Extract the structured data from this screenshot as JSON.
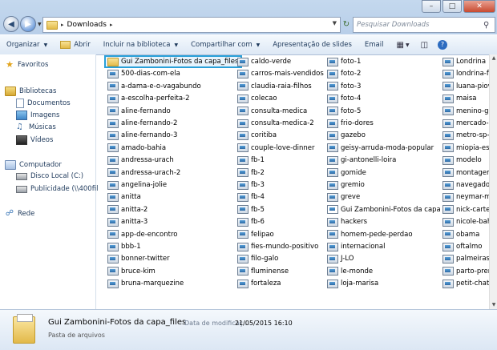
{
  "address": {
    "path": "Downloads"
  },
  "search": {
    "placeholder": "Pesquisar Downloads"
  },
  "toolbar": {
    "organize": "Organizar",
    "open": "Abrir",
    "include": "Incluir na biblioteca",
    "share": "Compartilhar com",
    "slideshow": "Apresentação de slides",
    "email": "Email"
  },
  "nav_pane": {
    "favorites": "Favoritos",
    "libraries": "Bibliotecas",
    "documents": "Documentos",
    "images": "Imagens",
    "music": "Músicas",
    "videos": "Vídeos",
    "computer": "Computador",
    "local_disk": "Disco Local (C:)",
    "network_drive": "Publicidade (\\\\400fil",
    "network": "Rede"
  },
  "files": {
    "col1": [
      "Gui Zambonini-Fotos da capa_files",
      "500-dias-com-ela",
      "a-dama-e-o-vagabundo",
      "a-escolha-perfeita-2",
      "aline-fernando",
      "aline-fernando-2",
      "aline-fernando-3",
      "amado-bahia",
      "andressa-urach",
      "andressa-urach-2",
      "angelina-jolie",
      "anitta",
      "anitta-2",
      "anitta-3",
      "app-de-encontro",
      "bbb-1",
      "bonner-twitter",
      "bruce-kim",
      "bruna-marquezine"
    ],
    "col2": [
      "caldo-verde",
      "carros-mais-vendidos",
      "claudia-raia-filhos",
      "colecao",
      "consulta-medica",
      "consulta-medica-2",
      "coritiba",
      "couple-love-dinner",
      "fb-1",
      "fb-2",
      "fb-3",
      "fb-4",
      "fb-5",
      "fb-6",
      "felipao",
      "fies-mundo-positivo",
      "filo-galo",
      "fluminense",
      "fortaleza"
    ],
    "col3": [
      "foto-1",
      "foto-2",
      "foto-3",
      "foto-4",
      "foto-5",
      "frio-dores",
      "gazebo",
      "geisy-arruda-moda-popular",
      "gi-antonelli-loira",
      "gomide",
      "gremio",
      "greve",
      "Gui Zambonini-Fotos da capa",
      "hackers",
      "homem-pede-perdao",
      "internacional",
      "J-LO",
      "le-monde",
      "loja-marisa"
    ],
    "col4": [
      "Londrina",
      "londrina-futel",
      "luana-piovani",
      "maisa",
      "menino-galin",
      "mercado-de-t",
      "metro-sp-mu",
      "miopia-estud",
      "modelo",
      "montagemlo",
      "navegadores",
      "neymar-mun",
      "nick-carter",
      "nicole-bahls",
      "obama",
      "oftalmo",
      "palmeiras-joi",
      "parto-prema",
      "petit-chateau"
    ]
  },
  "details": {
    "name": "Gui Zambonini-Fotos da capa_files",
    "type": "Pasta de arquivos",
    "modified_label": "Data de modificaç...",
    "modified_value": "21/05/2015 16:10"
  }
}
